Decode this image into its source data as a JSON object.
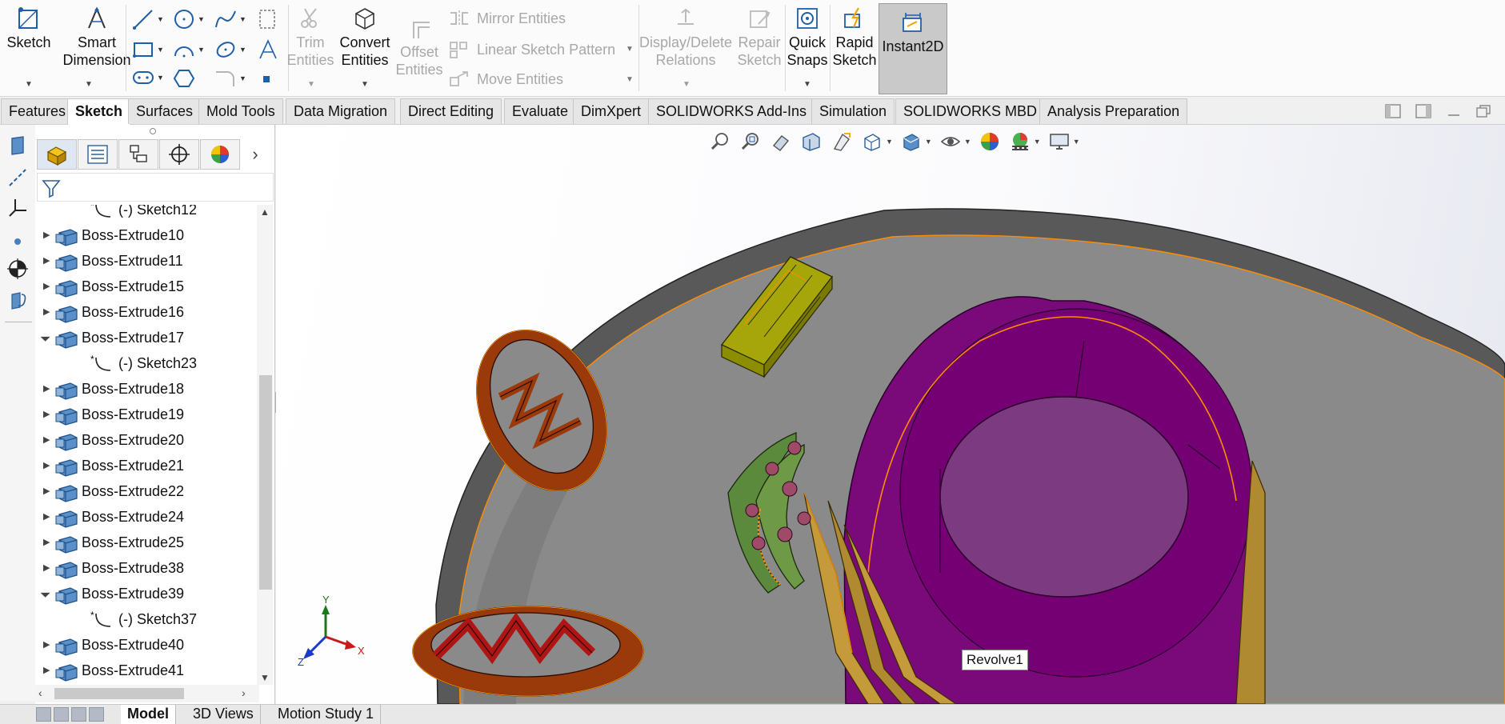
{
  "ribbon": {
    "sketch_label": "Sketch",
    "smart_dimension_label": "Smart\nDimension",
    "trim_label": "Trim\nEntities",
    "convert_label": "Convert\nEntities",
    "offset_label": "Offset\nEntities",
    "mirror_label": "Mirror Entities",
    "linear_pattern_label": "Linear Sketch Pattern",
    "move_label": "Move Entities",
    "display_delete_label": "Display/Delete\nRelations",
    "repair_label": "Repair\nSketch",
    "quick_snaps_label": "Quick\nSnaps",
    "rapid_sketch_label": "Rapid\nSketch",
    "instant2d_label": "Instant2D"
  },
  "tabs": [
    "Features",
    "Sketch",
    "Surfaces",
    "Mold Tools",
    "Data Migration",
    "Direct Editing",
    "Evaluate",
    "DimXpert",
    "SOLIDWORKS Add-Ins",
    "Simulation",
    "SOLIDWORKS MBD",
    "Analysis Preparation"
  ],
  "active_tab": "Sketch",
  "tree": [
    {
      "label": "(-) Sketch12",
      "type": "sketch",
      "expander": ""
    },
    {
      "label": "Boss-Extrude10",
      "type": "feature",
      "expander": "collapsed"
    },
    {
      "label": "Boss-Extrude11",
      "type": "feature",
      "expander": "collapsed"
    },
    {
      "label": "Boss-Extrude15",
      "type": "feature",
      "expander": "collapsed"
    },
    {
      "label": "Boss-Extrude16",
      "type": "feature",
      "expander": "collapsed"
    },
    {
      "label": "Boss-Extrude17",
      "type": "feature",
      "expander": "expanded"
    },
    {
      "label": "(-) Sketch23",
      "type": "sketch",
      "expander": ""
    },
    {
      "label": "Boss-Extrude18",
      "type": "feature",
      "expander": "collapsed"
    },
    {
      "label": "Boss-Extrude19",
      "type": "feature",
      "expander": "collapsed"
    },
    {
      "label": "Boss-Extrude20",
      "type": "feature",
      "expander": "collapsed"
    },
    {
      "label": "Boss-Extrude21",
      "type": "feature",
      "expander": "collapsed"
    },
    {
      "label": "Boss-Extrude22",
      "type": "feature",
      "expander": "collapsed"
    },
    {
      "label": "Boss-Extrude24",
      "type": "feature",
      "expander": "collapsed"
    },
    {
      "label": "Boss-Extrude25",
      "type": "feature",
      "expander": "collapsed"
    },
    {
      "label": "Boss-Extrude38",
      "type": "feature",
      "expander": "collapsed"
    },
    {
      "label": "Boss-Extrude39",
      "type": "feature",
      "expander": "expanded"
    },
    {
      "label": "(-) Sketch37",
      "type": "sketch",
      "expander": ""
    },
    {
      "label": "Boss-Extrude40",
      "type": "feature",
      "expander": "collapsed"
    },
    {
      "label": "Boss-Extrude41",
      "type": "feature",
      "expander": "collapsed"
    }
  ],
  "viewport": {
    "tooltip": "Revolve1",
    "triad": {
      "x": "X",
      "y": "Y",
      "z": "Z"
    }
  },
  "bottom_tabs": [
    "Model",
    "3D Views",
    "Motion Study 1"
  ],
  "active_bottom_tab": "Model",
  "colors": {
    "model_rim": "#595959",
    "model_floor": "#8a8a8a",
    "nucleus": "#7a0a7a",
    "nucleus_top": "#7c3a80",
    "mitochondria": "#9a3a0a",
    "ribosome_bar": "#a6a60a",
    "golgi": "#5c8a3c",
    "edge_highlight": "#ff8c00"
  }
}
